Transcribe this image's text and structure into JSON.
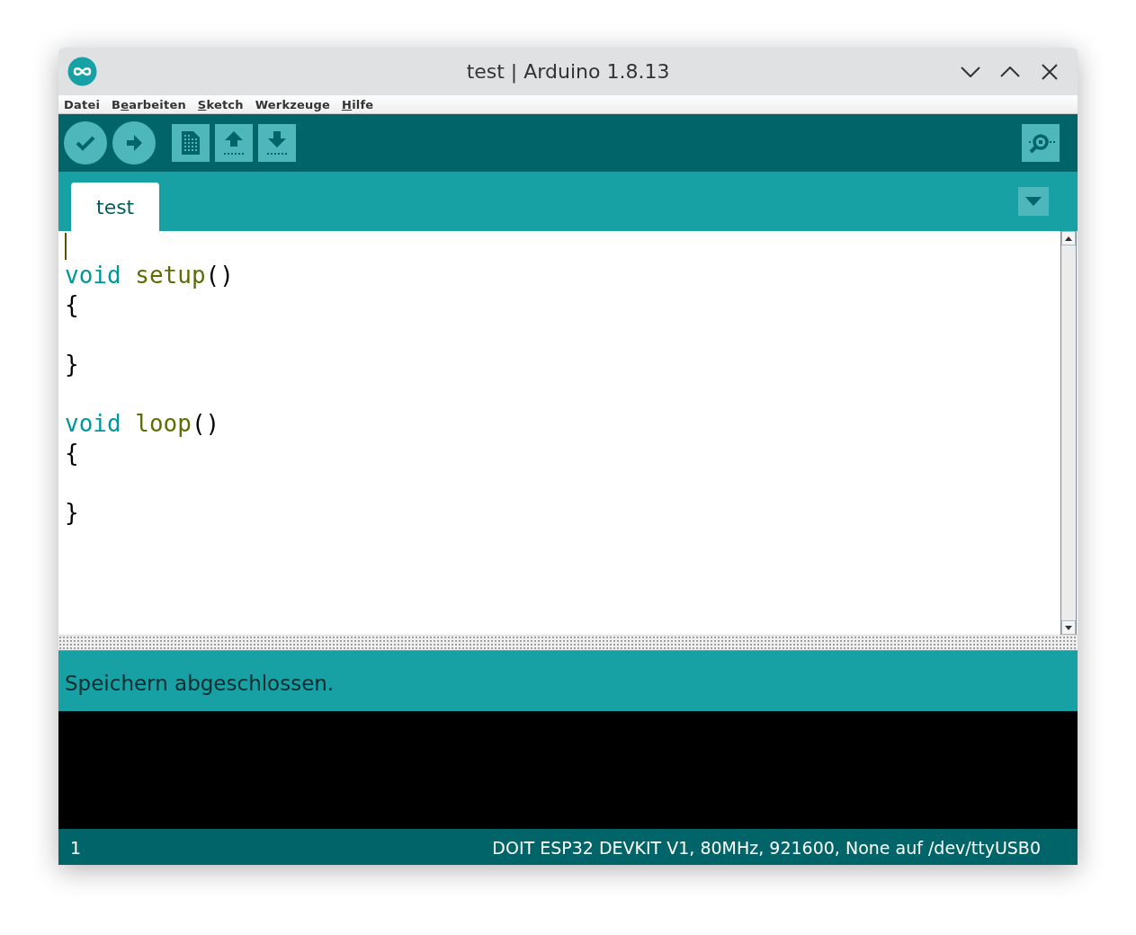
{
  "window": {
    "title": "test | Arduino 1.8.13"
  },
  "menu": [
    {
      "label": "Datei"
    },
    {
      "before": "B",
      "key": "e",
      "after": "arbeiten"
    },
    {
      "key": "S",
      "after": "ketch"
    },
    {
      "label": "Werkzeuge"
    },
    {
      "key": "H",
      "after": "ilfe"
    }
  ],
  "toolbar": [
    {
      "kind": "verify"
    },
    {
      "kind": "upload"
    },
    {
      "kind": "new"
    },
    {
      "kind": "open"
    },
    {
      "kind": "save"
    }
  ],
  "serial_monitor": {
    "kind": "monitor"
  },
  "tabs": [
    {
      "label": "test",
      "selected": true
    }
  ],
  "editor": {
    "lines": [
      {
        "kind": "blank",
        "cursor": true
      },
      {
        "kind": "code",
        "tokens": [
          {
            "text": "void",
            "kind": "keyword"
          },
          {
            "text": " setup",
            "kind": "function"
          },
          {
            "text": "()",
            "kind": "plain"
          }
        ]
      },
      {
        "kind": "code",
        "tokens": [
          {
            "text": "{",
            "kind": "plain"
          }
        ]
      },
      {
        "kind": "blank",
        "cursor": false
      },
      {
        "kind": "code",
        "tokens": [
          {
            "text": "}",
            "kind": "plain"
          }
        ]
      },
      {
        "kind": "blank",
        "cursor": false
      },
      {
        "kind": "code",
        "tokens": [
          {
            "text": "void",
            "kind": "keyword"
          },
          {
            "text": " loop",
            "kind": "function"
          },
          {
            "text": "()",
            "kind": "plain"
          }
        ]
      },
      {
        "kind": "code",
        "tokens": [
          {
            "text": "{",
            "kind": "plain"
          }
        ]
      },
      {
        "kind": "blank",
        "cursor": false
      },
      {
        "kind": "code",
        "tokens": [
          {
            "text": "}",
            "kind": "plain"
          }
        ]
      }
    ]
  },
  "status": {
    "message": "Speichern abgeschlossen."
  },
  "footer": {
    "line": "1",
    "board": "DOIT ESP32 DEVKIT V1, 80MHz, 921600, None auf /dev/ttyUSB0"
  }
}
